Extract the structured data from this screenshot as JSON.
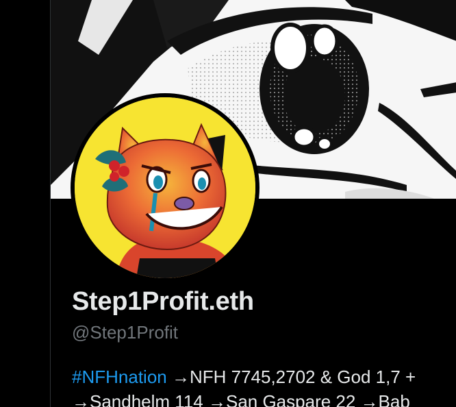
{
  "profile": {
    "display_name": "Step1Profit.eth",
    "handle": "@Step1Profit",
    "bio": {
      "hashtag": "#NFHnation",
      "line1_rest": " →NFH 7745,2702 & God 1,7 +",
      "line2": "→Sandhelm 114 →San Gaspare 22 →Bab"
    }
  },
  "colors": {
    "background": "#000000",
    "name_text": "#e7e9ea",
    "handle_text": "#71767b",
    "hashtag": "#1d9bf0",
    "avatar_bg": "#f7e431"
  },
  "icons": {
    "banner": "manga-eye-banner",
    "avatar": "fox-character-avatar"
  }
}
